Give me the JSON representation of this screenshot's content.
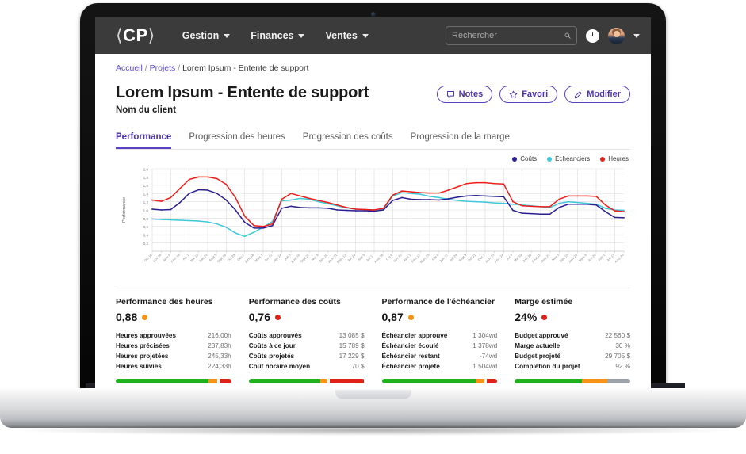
{
  "nav": {
    "brand": "CP",
    "brand_left": "⟨",
    "brand_right": "⟩",
    "items": [
      {
        "label": "Gestion"
      },
      {
        "label": "Finances"
      },
      {
        "label": "Ventes"
      }
    ],
    "search": {
      "placeholder": "Rechercher",
      "value": ""
    },
    "icons": {
      "search": "search-icon",
      "clock": "clock-icon",
      "avatar": "avatar"
    }
  },
  "breadcrumb": {
    "home": "Accueil",
    "projects": "Projets",
    "current": "Lorem Ipsum - Entente de support",
    "sep": "/"
  },
  "header": {
    "title": "Lorem Ipsum - Entente de support",
    "subtitle": "Nom du client",
    "buttons": [
      {
        "label": "Notes",
        "icon": "note-icon"
      },
      {
        "label": "Favori",
        "icon": "star-icon"
      },
      {
        "label": "Modifier",
        "icon": "pencil-icon"
      }
    ]
  },
  "tabs": [
    {
      "label": "Performance",
      "active": true
    },
    {
      "label": "Progression des heures",
      "active": false
    },
    {
      "label": "Progression des coûts",
      "active": false
    },
    {
      "label": "Progression de la marge",
      "active": false
    }
  ],
  "colors": {
    "accent": "#5b3fc4",
    "costs": "#2a1f8f",
    "schedule": "#3ec8da",
    "hours": "#ee1c18",
    "green": "#21b11f",
    "orange": "#f79317",
    "red": "#e02119",
    "grey": "#9ea3aa"
  },
  "chart_data": {
    "type": "line",
    "title": "",
    "xlabel": "",
    "ylabel": "Performance",
    "ylim": [
      0,
      2.0
    ],
    "yticks": [
      "0,2",
      "0,4",
      "0,6",
      "0,8",
      "1,0",
      "1,2",
      "1,4",
      "1,6",
      "1,8",
      "2,0"
    ],
    "ytick_values": [
      0.2,
      0.4,
      0.6,
      0.8,
      1.0,
      1.2,
      1.4,
      1.6,
      1.8,
      2.0
    ],
    "grid": true,
    "legend_position": "top-right",
    "categories": [
      "Oct 16",
      "Nov 28",
      "Janv 9",
      "Févr 18",
      "Avr 1",
      "Mai 13",
      "Juin 24",
      "Août 5",
      "Sept 16",
      "Oct 28",
      "Déc 7",
      "Janv 18",
      "Mars 1",
      "Avr 12",
      "Mai 24",
      "Juil 5",
      "Août 16",
      "Sept 27",
      "Nov 8",
      "Déc 20",
      "Janv 31",
      "Mars 13",
      "Avr 24",
      "Juin 5",
      "Juil 17",
      "Août 28",
      "Oct 9",
      "Nov 20",
      "Janv 1",
      "Févr 12",
      "Mars 25",
      "Mai 6",
      "Juin 17",
      "Juil 29",
      "Sept 9",
      "Oct 21",
      "Déc 2",
      "Janv 13",
      "Févr 24",
      "Avr 7",
      "Mai 19",
      "Juin 30",
      "Août 11",
      "Sept 22",
      "Nov 3",
      "Déc 15",
      "Janv 26",
      "Mars 9",
      "Avr 20",
      "Juin 1",
      "Juil 13",
      "Août 24"
    ],
    "legend": [
      {
        "name": "Coûts",
        "color": "#2a1f8f"
      },
      {
        "name": "Échéanciers",
        "color": "#3ec8da"
      },
      {
        "name": "Heures",
        "color": "#ee1c18"
      }
    ],
    "series": [
      {
        "name": "Heures",
        "color": "#ee1c18",
        "values": [
          1.24,
          1.21,
          1.3,
          1.52,
          1.74,
          1.8,
          1.8,
          1.76,
          1.62,
          1.3,
          0.85,
          0.62,
          0.6,
          0.66,
          1.26,
          1.4,
          1.34,
          1.28,
          1.23,
          1.18,
          1.12,
          1.06,
          1.02,
          1.01,
          1.0,
          1.04,
          1.36,
          1.46,
          1.44,
          1.42,
          1.41,
          1.41,
          1.48,
          1.56,
          1.64,
          1.66,
          1.66,
          1.64,
          1.63,
          1.2,
          1.1,
          1.09,
          1.08,
          1.08,
          1.26,
          1.34,
          1.34,
          1.34,
          1.33,
          1.12,
          0.98,
          0.96
        ]
      },
      {
        "name": "Coûts",
        "color": "#2a1f8f",
        "values": [
          1.02,
          1.0,
          1.01,
          1.18,
          1.4,
          1.49,
          1.48,
          1.4,
          1.24,
          1.0,
          0.7,
          0.56,
          0.56,
          0.62,
          1.04,
          1.09,
          1.06,
          1.05,
          1.05,
          1.04,
          1.0,
          0.99,
          0.98,
          0.98,
          0.97,
          1.0,
          1.23,
          1.3,
          1.26,
          1.25,
          1.25,
          1.24,
          1.27,
          1.31,
          1.34,
          1.35,
          1.34,
          1.33,
          1.32,
          0.99,
          0.92,
          0.91,
          0.9,
          0.9,
          1.06,
          1.14,
          1.14,
          1.14,
          1.12,
          0.96,
          0.82,
          0.81
        ]
      },
      {
        "name": "Échéanciers",
        "color": "#3ec8da",
        "values": [
          0.78,
          0.77,
          0.76,
          0.75,
          0.74,
          0.73,
          0.71,
          0.66,
          0.58,
          0.44,
          0.36,
          0.46,
          0.58,
          0.72,
          1.22,
          1.24,
          1.28,
          1.26,
          1.2,
          1.15,
          1.1,
          1.05,
          1.02,
          1.01,
          1.0,
          1.02,
          1.34,
          1.42,
          1.4,
          1.38,
          1.33,
          1.3,
          1.26,
          1.23,
          1.21,
          1.2,
          1.19,
          1.17,
          1.16,
          1.14,
          1.12,
          1.1,
          1.08,
          1.06,
          1.16,
          1.2,
          1.18,
          1.16,
          1.14,
          1.04,
          1.0,
          0.99
        ]
      }
    ]
  },
  "metrics": [
    {
      "title": "Performance des heures",
      "score": "0,88",
      "dot": "#f79317",
      "rows": [
        {
          "key": "Heures approuvées",
          "value": "216,00h"
        },
        {
          "key": "Heures précisées",
          "value": "237,83h"
        },
        {
          "key": "Heures projetées",
          "value": "245,33h"
        },
        {
          "key": "Heures suivies",
          "value": "224,33h"
        }
      ],
      "bar": [
        {
          "color": "#21b11f",
          "pct": 80
        },
        {
          "color": "#f79317",
          "pct": 8
        },
        {
          "color": "#ffffff",
          "pct": 2
        },
        {
          "color": "#e02119",
          "pct": 10
        }
      ]
    },
    {
      "title": "Performance des coûts",
      "score": "0,76",
      "dot": "#e02119",
      "rows": [
        {
          "key": "Coûts approuvés",
          "value": "13 085 $"
        },
        {
          "key": "Coûts à ce jour",
          "value": "15 789 $"
        },
        {
          "key": "Coûts projetés",
          "value": "17 229 $"
        },
        {
          "key": "Coût horaire moyen",
          "value": "70 $"
        }
      ],
      "bar": [
        {
          "color": "#21b11f",
          "pct": 62
        },
        {
          "color": "#f79317",
          "pct": 6
        },
        {
          "color": "#ffffff",
          "pct": 2
        },
        {
          "color": "#e02119",
          "pct": 30
        }
      ]
    },
    {
      "title": "Performance de l'échéancier",
      "score": "0,87",
      "dot": "#f79317",
      "rows": [
        {
          "key": "Échéancier approuvé",
          "value": "1 304wd"
        },
        {
          "key": "Échéancier écoulé",
          "value": "1 378wd"
        },
        {
          "key": "Échéancier restant",
          "value": "-74wd"
        },
        {
          "key": "Échéancier projeté",
          "value": "1 504wd"
        }
      ],
      "bar": [
        {
          "color": "#21b11f",
          "pct": 81
        },
        {
          "color": "#f79317",
          "pct": 8
        },
        {
          "color": "#ffffff",
          "pct": 2
        },
        {
          "color": "#e02119",
          "pct": 9
        }
      ]
    },
    {
      "title": "Marge estimée",
      "score": "24%",
      "dot": "#e02119",
      "rows": [
        {
          "key": "Budget approuvé",
          "value": "22 560 $"
        },
        {
          "key": "Marge actuelle",
          "value": "30 %"
        },
        {
          "key": "Budget projeté",
          "value": "29 705 $"
        },
        {
          "key": "Complétion du projet",
          "value": "92 %"
        }
      ],
      "bar": [
        {
          "color": "#21b11f",
          "pct": 58
        },
        {
          "color": "#f79317",
          "pct": 22
        },
        {
          "color": "#9ea3aa",
          "pct": 20
        }
      ]
    }
  ]
}
